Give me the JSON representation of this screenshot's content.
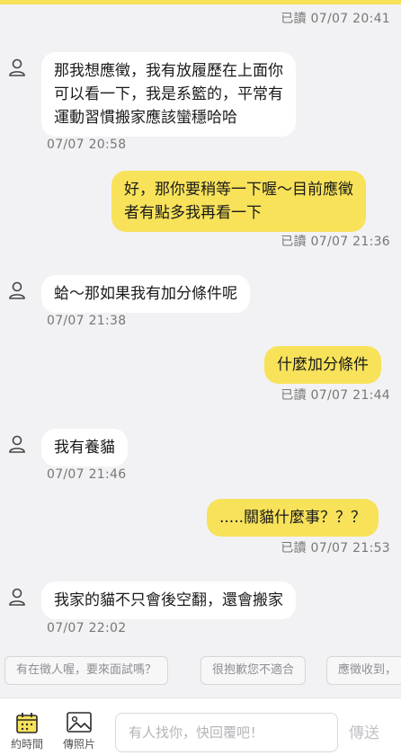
{
  "accent_color": "#f7e25a",
  "messages": [
    {
      "meta": "已讀 07/07 20:41"
    },
    {
      "lines": [
        "那我想應徵，我有放履歷在上面你",
        "可以看一下，我是系籃的，平常有",
        "運動習慣搬家應該蠻穩哈哈"
      ],
      "meta": "07/07 20:58"
    },
    {
      "lines": [
        "好，那你要稍等一下喔～目前應徵",
        "者有點多我再看一下"
      ],
      "meta": "已讀 07/07 21:36"
    },
    {
      "lines": [
        "蛤～那如果我有加分條件呢"
      ],
      "meta": "07/07 21:38"
    },
    {
      "lines": [
        "什麼加分條件"
      ],
      "meta": "已讀 07/07 21:44"
    },
    {
      "lines": [
        "我有養貓"
      ],
      "meta": "07/07 21:46"
    },
    {
      "lines": [
        ".....關貓什麼事？？？"
      ],
      "meta": "已讀 07/07 21:53"
    },
    {
      "lines": [
        "我家的貓不只會後空翻，還會搬家"
      ],
      "meta": "07/07 22:02"
    }
  ],
  "quick_replies": [
    "有在徵人喔，要來面試嗎？",
    "很抱歉您不適合",
    "應徵收到，"
  ],
  "toolbar": {
    "schedule_label": "約時間",
    "photo_label": "傳照片",
    "input_placeholder": "有人找你，快回覆吧！",
    "send_label": "傳送"
  }
}
